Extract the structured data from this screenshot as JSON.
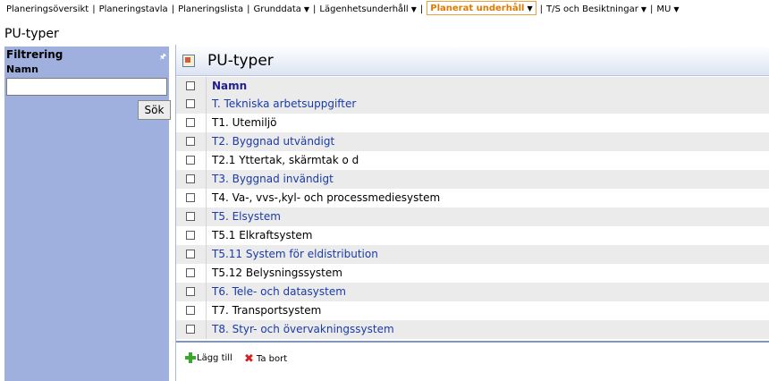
{
  "topnav": {
    "items": [
      {
        "label": "Planeringsöversikt",
        "dropdown": false
      },
      {
        "label": "Planeringstavla",
        "dropdown": false
      },
      {
        "label": "Planeringslista",
        "dropdown": false
      },
      {
        "label": "Grunddata",
        "dropdown": true
      },
      {
        "label": "Lägenhetsunderhåll",
        "dropdown": true
      },
      {
        "label": "Planerat underhåll",
        "dropdown": true,
        "active": true
      },
      {
        "label": "T/S och Besiktningar",
        "dropdown": true
      },
      {
        "label": "MU",
        "dropdown": true
      }
    ]
  },
  "page": {
    "title": "PU-typer"
  },
  "sidebar": {
    "title": "Filtrering",
    "pin_icon": "pin-icon",
    "field_label": "Namn",
    "field_value": "",
    "search_button": "Sök"
  },
  "panel": {
    "title": "PU-typer",
    "header_icon": "list-icon",
    "column_header": "Namn",
    "rows": [
      {
        "name": "T. Tekniska arbetsuppgifter"
      },
      {
        "name": "T1. Utemiljö"
      },
      {
        "name": "T2. Byggnad utvändigt"
      },
      {
        "name": "T2.1 Yttertak, skärmtak o d"
      },
      {
        "name": "T3. Byggnad invändigt"
      },
      {
        "name": "T4. Va-, vvs-,kyl- och processmediesystem"
      },
      {
        "name": "T5. Elsystem"
      },
      {
        "name": "T5.1 Elkraftsystem"
      },
      {
        "name": "T5.11 System för eldistribution"
      },
      {
        "name": "T5.12 Belysningssystem"
      },
      {
        "name": "T6. Tele- och datasystem"
      },
      {
        "name": "T7. Transportsystem"
      },
      {
        "name": "T8. Styr- och övervakningssystem"
      }
    ],
    "footer": {
      "add_label": "Lägg till",
      "delete_label": "Ta bort"
    }
  },
  "colors": {
    "sidebar_bg": "#9fb0de",
    "active_nav": "#e07a00",
    "link_blue": "#1a3aa8"
  }
}
